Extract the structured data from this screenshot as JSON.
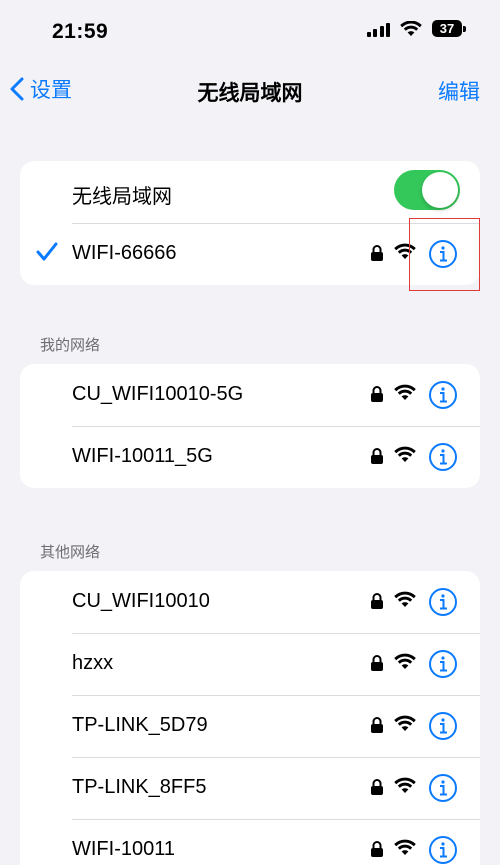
{
  "status_bar": {
    "time": "21:59",
    "battery": "37"
  },
  "nav": {
    "back_label": "设置",
    "title": "无线局域网",
    "edit_label": "编辑"
  },
  "wlan_group": {
    "toggle_label": "无线局域网",
    "toggle_on": true,
    "connected_network": "WIFI-66666"
  },
  "my_networks": {
    "header": "我的网络",
    "items": [
      {
        "name": "CU_WIFI10010-5G"
      },
      {
        "name": "WIFI-10011_5G"
      }
    ]
  },
  "other_networks": {
    "header": "其他网络",
    "items": [
      {
        "name": "CU_WIFI10010"
      },
      {
        "name": "hzxx"
      },
      {
        "name": "TP-LINK_5D79"
      },
      {
        "name": "TP-LINK_8FF5"
      },
      {
        "name": "WIFI-10011"
      }
    ]
  },
  "colors": {
    "accent": "#0a7aff",
    "toggle_on": "#34c759",
    "highlight": "#e03a3a"
  }
}
